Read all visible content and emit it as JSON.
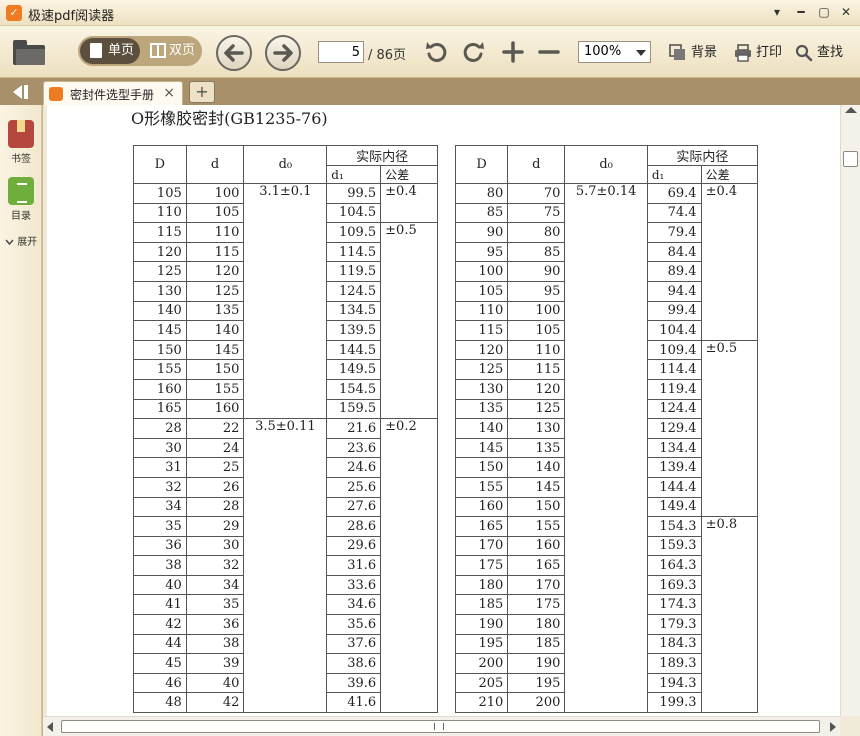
{
  "window": {
    "title": "极速pdf阅读器",
    "menu_glyph": "▾",
    "minimize_glyph": "━",
    "maximize_glyph": "▢",
    "close_glyph": "✕"
  },
  "toolbar": {
    "single_page": "单页",
    "double_page": "双页",
    "current_page": "5",
    "total_pages": "/ 86页",
    "zoom": "100%",
    "background": "背景",
    "print": "打印",
    "find": "查找"
  },
  "tabs": {
    "doc_tab_label": "密封件选型手册",
    "close_glyph": "×",
    "new_tab_glyph": "+"
  },
  "sidebar": {
    "bookmarks": "书签",
    "toc": "目录",
    "expand": "展开"
  },
  "document": {
    "title": "O形橡胶密封(GB1235-76)",
    "headers": {
      "D": "D",
      "d": "d",
      "d0": "d₀",
      "actual_id": "实际内径",
      "d1": "d₁",
      "tolerance": "公差"
    },
    "left_table": {
      "rows": [
        [
          "105",
          "100"
        ],
        [
          "110",
          "105"
        ],
        [
          "115",
          "110"
        ],
        [
          "120",
          "115"
        ],
        [
          "125",
          "120"
        ],
        [
          "130",
          "125"
        ],
        [
          "140",
          "135"
        ],
        [
          "145",
          "140"
        ],
        [
          "150",
          "145"
        ],
        [
          "155",
          "150"
        ],
        [
          "160",
          "155"
        ],
        [
          "165",
          "160"
        ],
        [
          "28",
          "22"
        ],
        [
          "30",
          "24"
        ],
        [
          "31",
          "25"
        ],
        [
          "32",
          "26"
        ],
        [
          "34",
          "28"
        ],
        [
          "35",
          "29"
        ],
        [
          "36",
          "30"
        ],
        [
          "38",
          "32"
        ],
        [
          "40",
          "34"
        ],
        [
          "41",
          "35"
        ],
        [
          "42",
          "36"
        ],
        [
          "44",
          "38"
        ],
        [
          "45",
          "39"
        ],
        [
          "46",
          "40"
        ],
        [
          "48",
          "42"
        ]
      ],
      "d1": [
        "99.5",
        "104.5",
        "109.5",
        "114.5",
        "119.5",
        "124.5",
        "134.5",
        "139.5",
        "144.5",
        "149.5",
        "154.5",
        "159.5",
        "21.6",
        "23.6",
        "24.6",
        "25.6",
        "27.6",
        "28.6",
        "29.6",
        "31.6",
        "33.6",
        "34.6",
        "35.6",
        "37.6",
        "38.6",
        "39.6",
        "41.6"
      ],
      "d0_groups": [
        {
          "value": "3.1±0.1",
          "rows": 12
        },
        {
          "value": "3.5±0.11",
          "rows": 15
        }
      ],
      "tol_groups": [
        {
          "value": "±0.4",
          "rows": 2
        },
        {
          "value": "±0.5",
          "rows": 10
        },
        {
          "value": "±0.2",
          "rows": 15
        }
      ]
    },
    "right_table": {
      "rows": [
        [
          "80",
          "70"
        ],
        [
          "85",
          "75"
        ],
        [
          "90",
          "80"
        ],
        [
          "95",
          "85"
        ],
        [
          "100",
          "90"
        ],
        [
          "105",
          "95"
        ],
        [
          "110",
          "100"
        ],
        [
          "115",
          "105"
        ],
        [
          "120",
          "110"
        ],
        [
          "125",
          "115"
        ],
        [
          "130",
          "120"
        ],
        [
          "135",
          "125"
        ],
        [
          "140",
          "130"
        ],
        [
          "145",
          "135"
        ],
        [
          "150",
          "140"
        ],
        [
          "155",
          "145"
        ],
        [
          "160",
          "150"
        ],
        [
          "165",
          "155"
        ],
        [
          "170",
          "160"
        ],
        [
          "175",
          "165"
        ],
        [
          "180",
          "170"
        ],
        [
          "185",
          "175"
        ],
        [
          "190",
          "180"
        ],
        [
          "195",
          "185"
        ],
        [
          "200",
          "190"
        ],
        [
          "205",
          "195"
        ],
        [
          "210",
          "200"
        ]
      ],
      "d1": [
        "69.4",
        "74.4",
        "79.4",
        "84.4",
        "89.4",
        "94.4",
        "99.4",
        "104.4",
        "109.4",
        "114.4",
        "119.4",
        "124.4",
        "129.4",
        "134.4",
        "139.4",
        "144.4",
        "149.4",
        "154.3",
        "159.3",
        "164.3",
        "169.3",
        "174.3",
        "179.3",
        "184.3",
        "189.3",
        "194.3",
        "199.3"
      ],
      "d0_groups": [
        {
          "value": "5.7±0.14",
          "rows": 27
        }
      ],
      "tol_groups": [
        {
          "value": "±0.4",
          "rows": 8
        },
        {
          "value": "±0.5",
          "rows": 9
        },
        {
          "value": "±0.8",
          "rows": 10
        }
      ]
    }
  },
  "colors": {
    "accent": "#ef7b22",
    "toolbar_bg": "#f3e9cf",
    "tabstrip_bg": "#a8916a"
  },
  "icons": {
    "app": "pdf-reader-logo-icon",
    "open": "folder-icon",
    "prev": "arrow-left-icon",
    "next": "arrow-right-icon",
    "rotate_left": "rotate-left-icon",
    "rotate_right": "rotate-right-icon",
    "zoom_in": "plus-icon",
    "zoom_out": "minus-icon",
    "background": "background-icon",
    "print": "printer-icon",
    "find": "magnifier-icon",
    "back": "collapse-panel-icon",
    "bookmarks": "bookmark-icon",
    "toc": "toc-icon"
  }
}
